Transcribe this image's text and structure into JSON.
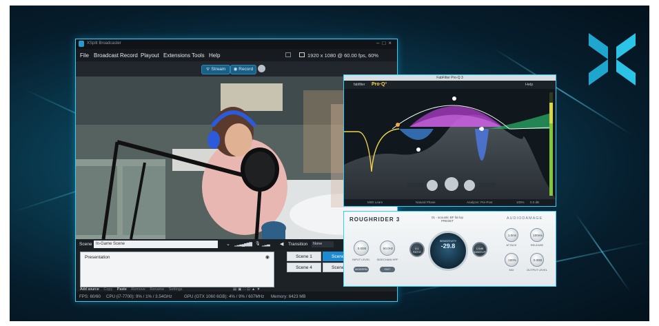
{
  "colors": {
    "accent": "#2fd2ff",
    "record_blue": "#1c5f85",
    "scene_active": "#1e8bd0",
    "proq_gold": "#ffd64a"
  },
  "brand_logo": {
    "icon": "xsplit-chevron-logo"
  },
  "xsplit": {
    "title": "XSplit Broadcaster",
    "menu": [
      "File",
      "Broadcast",
      "Record",
      "Playout",
      "Extensions",
      "Tools",
      "Help"
    ],
    "resolution": "1920 x 1080 @ 60.00 fps, 60%",
    "toolbar": {
      "stream_label": "Stream",
      "record_label": "Record"
    },
    "scene_label": "Scene",
    "scene_name": "In-Game Scene",
    "transition_label": "Transition",
    "transition_value": "None",
    "sources": {
      "item": "Presentation"
    },
    "add_source": {
      "add": "Add source",
      "copy": "Copy",
      "paste": "Paste",
      "remove": "Remove",
      "rename": "Rename",
      "settings": "Settings"
    },
    "scenes": [
      {
        "label": "Scene 1",
        "active": false
      },
      {
        "label": "Scene",
        "active": true
      },
      {
        "label": "Scene 4",
        "active": false
      },
      {
        "label": "Scene",
        "active": false
      }
    ],
    "status": {
      "fps": "FPS: 60/60",
      "cpu": "CPU (i7-7700): 9% / 1% / 3.54GHz",
      "gpu": "GPU (GTX 1060 6GB): 4% / 9% / 607MHz",
      "memory": "Memory: 6423 MB"
    }
  },
  "proq": {
    "title": "FabFilter Pro-Q 3",
    "brand": "fabfilter",
    "product": "Pro·Q³",
    "help": "Help",
    "footer": {
      "midi": "MIDI Learn",
      "phase": "Natural Phase",
      "analyzer": "Analyzer: Pre-Post",
      "zoom": "100%",
      "out": "0.0 dB"
    }
  },
  "roughrider": {
    "title": "ROUGHRIDER 3",
    "preset_line1": "01 - acoustic BF fat lop",
    "preset_line2": "PRESET",
    "maker": "AUDIODAMAGE",
    "knobs": {
      "input": {
        "value": "0.0DB",
        "label": "INPUT LEVEL"
      },
      "sidechain": {
        "value": "50.0Hz",
        "label": "SIDECHAIN HPF"
      },
      "attack": {
        "value": "1.0ms",
        "label": "ATTACK"
      },
      "release": {
        "value": "100ms",
        "label": "RELEASE"
      },
      "mix": {
        "value": "100%",
        "label": "MIX"
      },
      "output": {
        "value": "0.0DB",
        "label": "OUTPUT LEVEL"
      }
    },
    "buttons": {
      "modern": "MODERN",
      "fast": "FAST SIDECHAIN"
    },
    "ratio_label": "RATIO",
    "ratio_value": "4:1",
    "makeup_label": "MAKEUP",
    "makeup_value": "1.0dB",
    "sensitivity_label": "SENSITIVITY",
    "sensitivity_value": "-29.8"
  }
}
